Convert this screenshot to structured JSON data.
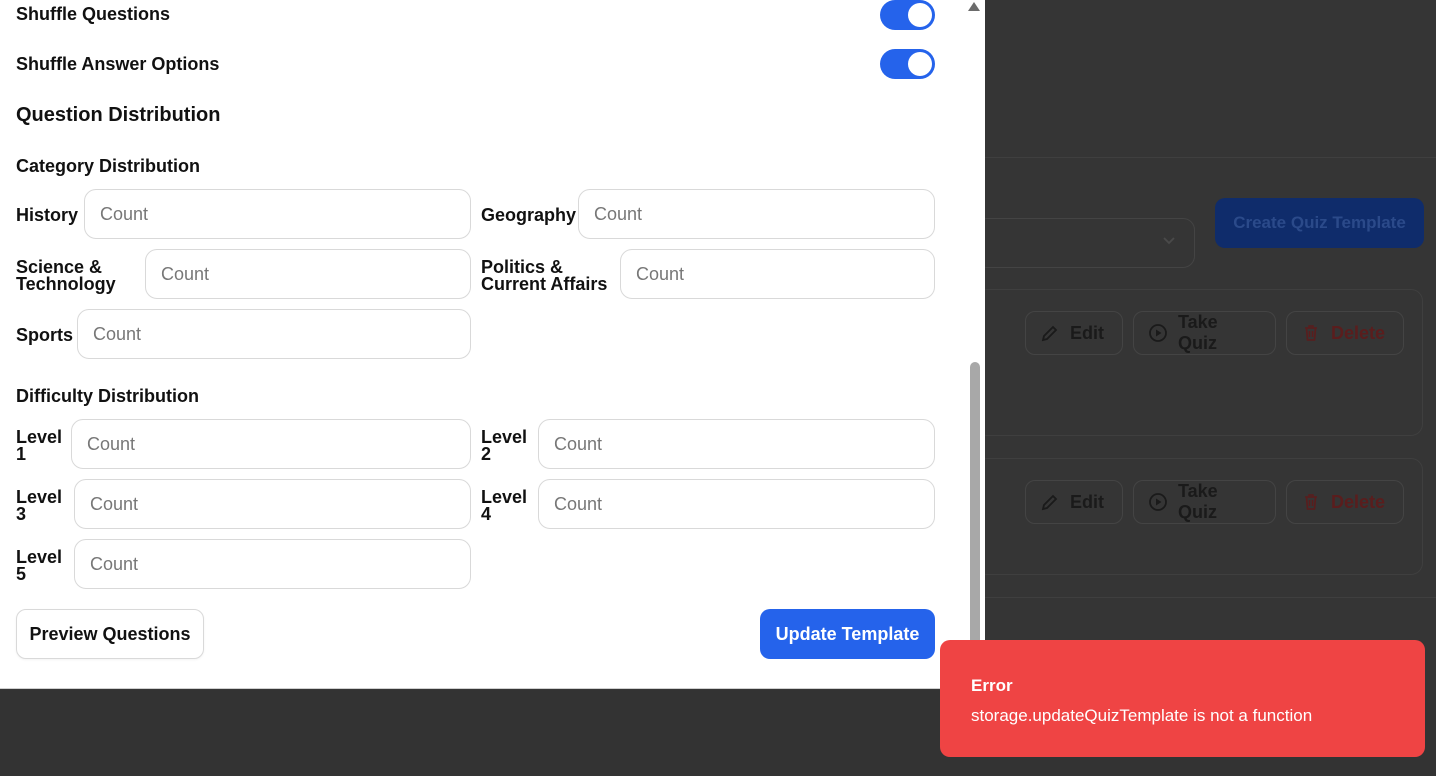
{
  "settings": {
    "shuffle_questions": {
      "label": "Shuffle Questions",
      "enabled": true
    },
    "shuffle_answers": {
      "label": "Shuffle Answer Options",
      "enabled": true
    }
  },
  "distribution": {
    "title": "Question Distribution",
    "category": {
      "title": "Category Distribution",
      "placeholder": "Count",
      "items": [
        {
          "label": "History"
        },
        {
          "label": "Geography"
        },
        {
          "label_line1": "Science &",
          "label_line2": "Technology"
        },
        {
          "label_line1": "Politics &",
          "label_line2": "Current Affairs"
        },
        {
          "label": "Sports"
        }
      ]
    },
    "difficulty": {
      "title": "Difficulty Distribution",
      "placeholder": "Count",
      "items": [
        {
          "line1": "Level",
          "line2": "1"
        },
        {
          "line1": "Level",
          "line2": "2"
        },
        {
          "line1": "Level",
          "line2": "3"
        },
        {
          "line1": "Level",
          "line2": "4"
        },
        {
          "line1": "Level",
          "line2": "5"
        }
      ]
    }
  },
  "actions": {
    "preview_label": "Preview Questions",
    "update_label": "Update Template"
  },
  "background": {
    "create_label": "Create Quiz Template",
    "card_actions": {
      "edit": "Edit",
      "take": "Take Quiz",
      "delete": "Delete"
    }
  },
  "toast": {
    "title": "Error",
    "message": "storage.updateQuizTemplate is not a function",
    "color": "#ef4444"
  },
  "colors": {
    "primary": "#2563eb",
    "overlay": "#333333"
  }
}
